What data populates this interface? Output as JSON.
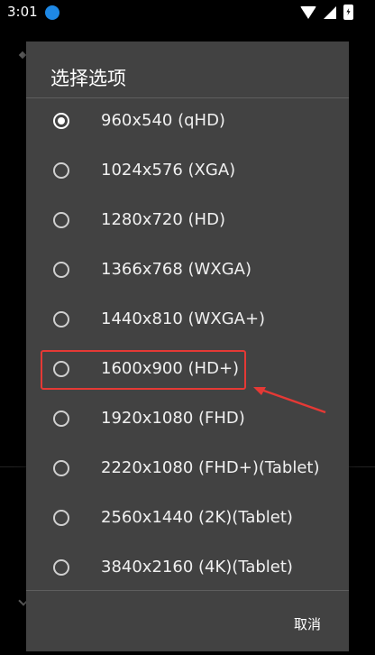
{
  "status_bar": {
    "time": "3:01"
  },
  "dialog": {
    "title": "选择选项",
    "options": [
      {
        "label": "960x540 (qHD)",
        "checked": true
      },
      {
        "label": "1024x576 (XGA)",
        "checked": false
      },
      {
        "label": "1280x720 (HD)",
        "checked": false
      },
      {
        "label": "1366x768 (WXGA)",
        "checked": false
      },
      {
        "label": "1440x810 (WXGA+)",
        "checked": false
      },
      {
        "label": "1600x900 (HD+)",
        "checked": false
      },
      {
        "label": "1920x1080 (FHD)",
        "checked": false
      },
      {
        "label": "2220x1080 (FHD+)(Tablet)",
        "checked": false
      },
      {
        "label": "2560x1440 (2K)(Tablet)",
        "checked": false
      },
      {
        "label": "3840x2160 (4K)(Tablet)",
        "checked": false
      }
    ],
    "cancel_label": "取消"
  },
  "annotation": {
    "highlight_color": "#e53935"
  }
}
